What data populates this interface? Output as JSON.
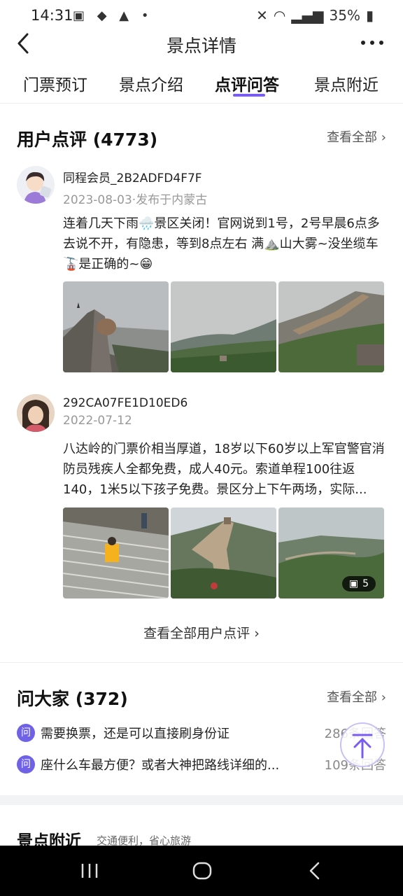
{
  "status": {
    "time": "14:31",
    "battery": "35%"
  },
  "header": {
    "title": "景点详情"
  },
  "tabs": [
    {
      "label": "门票预订",
      "active": false
    },
    {
      "label": "景点介绍",
      "active": false
    },
    {
      "label": "点评问答",
      "active": true
    },
    {
      "label": "景点附近",
      "active": false
    }
  ],
  "reviews": {
    "title": "用户点评 (4773)",
    "see_all": "查看全部",
    "items": [
      {
        "user": "同程会员_2B2ADFD4F7F",
        "date": "2023-08-03·发布于内蒙古",
        "text": "连着几天下雨🌧️景区关闭！官网说到1号，2号早晨6点多去说不开，有隐患，等到8点左右 满⛰️山大雾~没坐缆车🚡是正确的~😁"
      },
      {
        "user": "292CA07FE1D10ED6",
        "date": "2022-07-12",
        "text": "八达岭的门票价相当厚道，18岁以下60岁以上军官警官消防员残疾人全都免费，成人40元。索道单程100往返140，1米5以下孩子免费。景区分上下午两场，实际...",
        "photo_count": "5"
      }
    ],
    "view_all": "查看全部用户点评"
  },
  "qa": {
    "title": "问大家 (372)",
    "see_all": "查看全部",
    "badge": "问",
    "items": [
      {
        "question": "需要换票，还是可以直接刷身份证",
        "answers": "286条回答"
      },
      {
        "question": "座什么车最方便？或者大神把路线详细的...",
        "answers": "109条回答"
      }
    ]
  },
  "nearby": {
    "title": "景点附近",
    "subtitle": "交通便利，省心旅游"
  }
}
